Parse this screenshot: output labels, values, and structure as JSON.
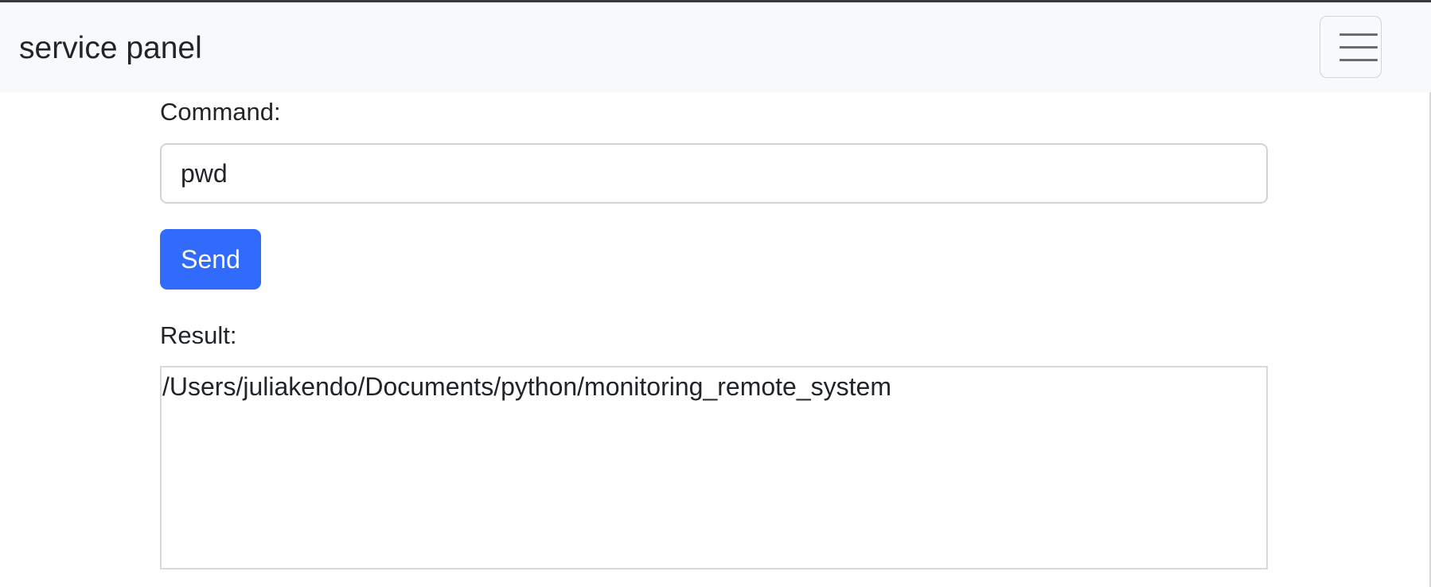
{
  "navbar": {
    "brand": "service panel",
    "toggle_icon": "hamburger-menu-icon"
  },
  "form": {
    "command_label": "Command:",
    "command_value": "pwd",
    "send_label": "Send",
    "result_label": "Result:",
    "result_value": "/Users/juliakendo/Documents/python/monitoring_remote_system"
  },
  "colors": {
    "navbar_bg": "#f8f9fa",
    "primary": "#316bfb",
    "text": "#212529"
  }
}
